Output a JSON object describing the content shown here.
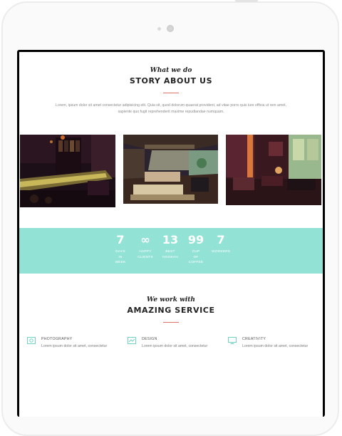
{
  "story": {
    "script_title": "What we do",
    "title": "STORY ABOUT US",
    "intro_line_1": "Lorem, ipsum dolor sit amet consectetur adipisicing elit. Quia sit, quod dolorum quaerat provident, ad vitae porro quis iure officia ut rem amet,",
    "intro_line_2": "sapiente quo fugit reprehenderit maxime repudiandae numquam."
  },
  "stats": [
    {
      "number": "7",
      "label_lines": [
        "DAYS",
        "IN",
        "WEEK"
      ]
    },
    {
      "number": "∞",
      "label_lines": [
        "HAPPY",
        "CLIENTS"
      ]
    },
    {
      "number": "13",
      "label_lines": [
        "BEST",
        "HOOKAH"
      ]
    },
    {
      "number": "99",
      "label_lines": [
        "CUP",
        "OF",
        "COFFEE"
      ]
    },
    {
      "number": "7",
      "label_lines": [
        "WORKERS"
      ]
    }
  ],
  "service_section": {
    "script_title": "We work with",
    "title": "AMAZING SERVICE"
  },
  "services": [
    {
      "title": "PHOTOGRAPHY",
      "text": "Lorem ipsum dolor sit amet, consectetur",
      "icon": "photography-icon"
    },
    {
      "title": "DESIGN",
      "text": "Lorem ipsum dolor sit amet, consectetur",
      "icon": "design-icon"
    },
    {
      "title": "CREATIVITY",
      "text": "Lorem ipsum dolor sit amet, consectetur",
      "icon": "creativity-icon"
    }
  ],
  "colors": {
    "accent": "#93e2d6",
    "divider": "#e0706a",
    "icon": "#6fd3c4"
  }
}
